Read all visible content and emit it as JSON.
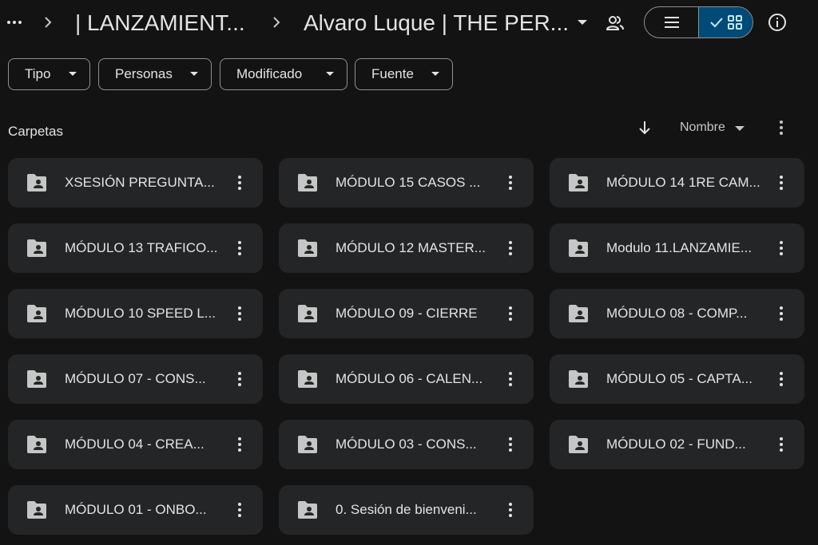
{
  "breadcrumb": {
    "items": [
      "| LANZAMIENT...",
      "Alvaro Luque | THE PER..."
    ]
  },
  "filters": [
    {
      "label": "Tipo"
    },
    {
      "label": "Personas"
    },
    {
      "label": "Modificado"
    },
    {
      "label": "Fuente"
    }
  ],
  "section": {
    "title": "Carpetas"
  },
  "sort": {
    "label": "Nombre",
    "direction": "descending"
  },
  "view": {
    "active": "grid"
  },
  "folders": [
    {
      "name": "XSESIÓN PREGUNTA..."
    },
    {
      "name": "MÓDULO 15 CASOS ..."
    },
    {
      "name": "MÓDULO 14 1RE CAM..."
    },
    {
      "name": "MÓDULO 13 TRAFICO..."
    },
    {
      "name": "MÓDULO 12 MASTER..."
    },
    {
      "name": "Modulo 11.LANZAMIE..."
    },
    {
      "name": "MÓDULO 10 SPEED L..."
    },
    {
      "name": "MÓDULO 09 - CIERRE"
    },
    {
      "name": "MÓDULO 08 - COMP..."
    },
    {
      "name": "MÓDULO 07 - CONS..."
    },
    {
      "name": "MÓDULO 06 - CALEN..."
    },
    {
      "name": "MÓDULO 05 - CAPTA..."
    },
    {
      "name": "MÓDULO 04 - CREA..."
    },
    {
      "name": "MÓDULO 03 - CONS..."
    },
    {
      "name": "MÓDULO 02 - FUND..."
    },
    {
      "name": "MÓDULO 01 - ONBO..."
    },
    {
      "name": "0. Sesión de bienveni..."
    }
  ],
  "colors": {
    "background": "#131314",
    "card": "#242526",
    "accent": "#004a77",
    "text": "#e3e3e3"
  }
}
